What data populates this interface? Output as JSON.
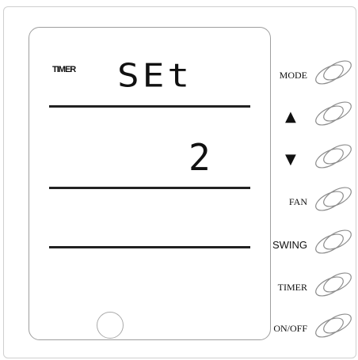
{
  "display": {
    "timer_label": "TIMER",
    "set_text": "SEt",
    "value": "2"
  },
  "buttons": {
    "mode": "MODE",
    "up": "▲",
    "down": "▼",
    "fan": "FAN",
    "swing": "SWING",
    "timer": "TIMER",
    "onoff": "ON/OFF"
  },
  "icons": {
    "up": "triangle-up-icon",
    "down": "triangle-down-icon"
  }
}
